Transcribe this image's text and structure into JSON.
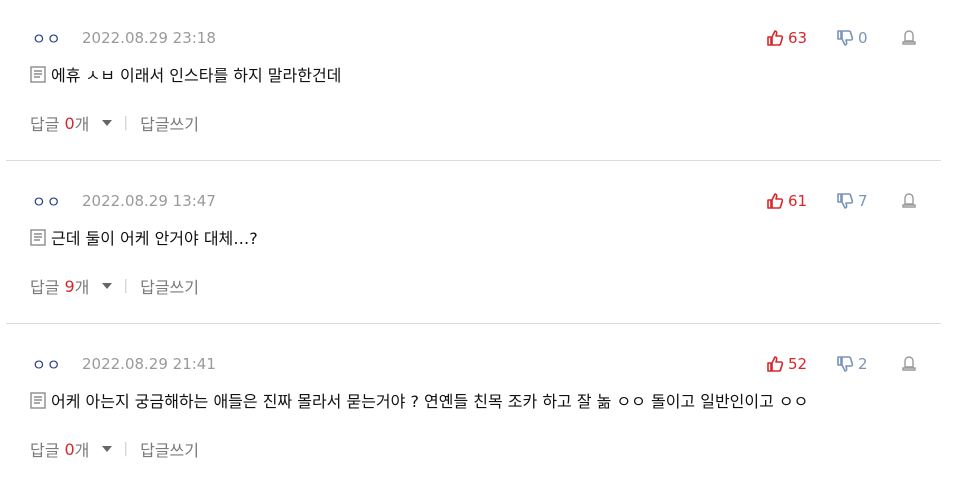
{
  "comments": [
    {
      "author": "ㅇㅇ",
      "date": "2022.08.29 23:18",
      "likes": "63",
      "dislikes": "0",
      "text": "에휴 ㅅㅂ 이래서 인스타를 하지 말라한건데",
      "reply_label": "답글",
      "reply_count": "0",
      "reply_unit": "개",
      "separator": "|",
      "write_reply_label": "답글쓰기"
    },
    {
      "author": "ㅇㅇ",
      "date": "2022.08.29 13:47",
      "likes": "61",
      "dislikes": "7",
      "text": "근데 둘이 어케 안거야 대체…?",
      "reply_label": "답글",
      "reply_count": "9",
      "reply_unit": "개",
      "separator": "|",
      "write_reply_label": "답글쓰기"
    },
    {
      "author": "ㅇㅇ",
      "date": "2022.08.29 21:41",
      "likes": "52",
      "dislikes": "2",
      "text": "어케 아는지 궁금해하는 애들은 진짜 몰라서 묻는거야 ? 연옌들 친목 조카 하고 잘 놂 ㅇㅇ 돌이고 일반인이고 ㅇㅇ",
      "reply_label": "답글",
      "reply_count": "0",
      "reply_unit": "개",
      "separator": "|",
      "write_reply_label": "답글쓰기"
    }
  ],
  "colors": {
    "like": "#d8262b",
    "dislike": "#7a93b7",
    "author": "#2a3a8c",
    "date": "#9a9a9a",
    "reply_count": "#d8262b",
    "divider": "#dcdcdc"
  },
  "icons": {
    "like": "thumbs-up-icon",
    "dislike": "thumbs-down-icon",
    "report": "report-icon",
    "memo": "memo-icon",
    "expand": "caret-down-icon"
  }
}
